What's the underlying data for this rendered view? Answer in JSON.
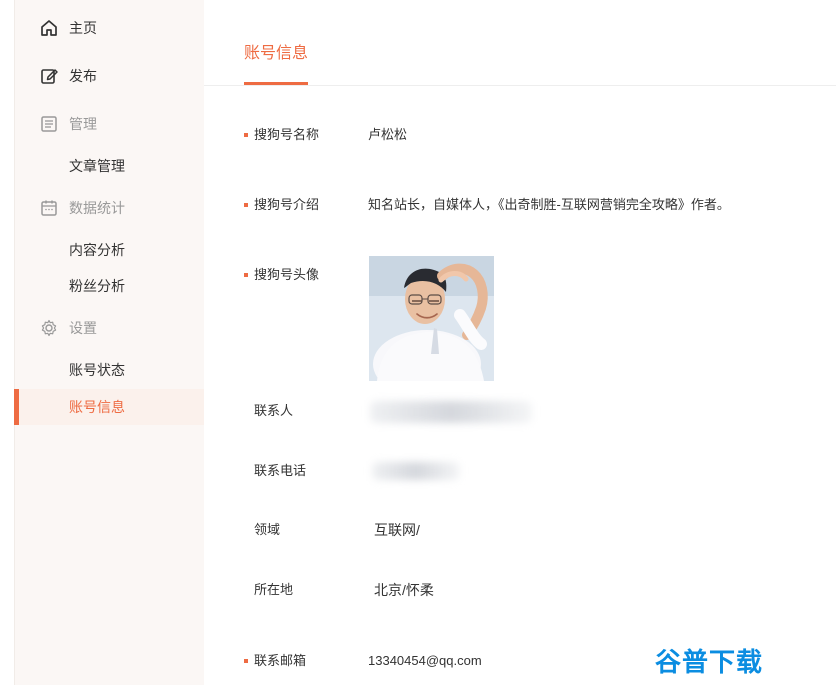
{
  "sidebar": {
    "items": [
      {
        "label": "主页",
        "icon": "home-icon",
        "type": "main"
      },
      {
        "label": "发布",
        "icon": "edit-icon",
        "type": "main"
      },
      {
        "label": "管理",
        "icon": "document-icon",
        "type": "group"
      },
      {
        "label": "文章管理",
        "type": "sub"
      },
      {
        "label": "数据统计",
        "icon": "calendar-icon",
        "type": "group"
      },
      {
        "label": "内容分析",
        "type": "sub"
      },
      {
        "label": "粉丝分析",
        "type": "sub"
      },
      {
        "label": "设置",
        "icon": "gear-icon",
        "type": "group"
      },
      {
        "label": "账号状态",
        "type": "sub"
      },
      {
        "label": "账号信息",
        "type": "sub",
        "active": true
      }
    ]
  },
  "main": {
    "tab": "账号信息",
    "fields": [
      {
        "label": "搜狗号名称",
        "value": "卢松松",
        "required": true
      },
      {
        "label": "搜狗号介绍",
        "value": "知名站长，自媒体人，《出奇制胜-互联网营销完全攻略》作者。",
        "required": true
      },
      {
        "label": "搜狗号头像",
        "value": "",
        "required": true
      },
      {
        "label": "联系人",
        "value": "",
        "required": false
      },
      {
        "label": "联系电话",
        "value": "",
        "required": false
      },
      {
        "label": "领域",
        "value": "互联网/",
        "required": false
      },
      {
        "label": "所在地",
        "value": "北京/怀柔",
        "required": false
      },
      {
        "label": "联系邮箱",
        "value": "13340454@qq.com",
        "required": true
      }
    ]
  },
  "watermark": "谷普下载",
  "colors": {
    "accent": "#ee6b42",
    "sidebar_bg": "#fbf7f5",
    "active_bg": "#fbf1ec",
    "watermark": "#0b8de1"
  }
}
